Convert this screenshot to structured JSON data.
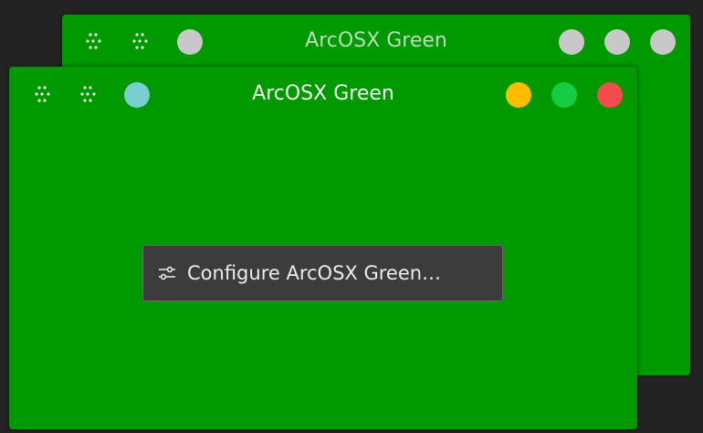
{
  "back_window": {
    "title": "ArcOSX Green",
    "left_buttons": [
      {
        "icon": "keep-above-icon"
      },
      {
        "icon": "keep-below-icon"
      }
    ],
    "menu_button_color": "#c8c8c8",
    "control_colors": [
      "#c8c8c8",
      "#c8c8c8",
      "#c8c8c8"
    ]
  },
  "front_window": {
    "title": "ArcOSX Green",
    "left_buttons": [
      {
        "icon": "keep-above-icon"
      },
      {
        "icon": "keep-below-icon"
      }
    ],
    "menu_button_color": "#79cfd0",
    "controls": {
      "minimize_color": "#ffbd00",
      "maximize_color": "#16cc45",
      "close_color": "#f44d4d"
    },
    "configure_label": "Configure ArcOSX Green…",
    "configure_icon": "configure-sliders-icon"
  },
  "colors": {
    "window_bg": "#009900",
    "desktop_bg": "#232323"
  }
}
